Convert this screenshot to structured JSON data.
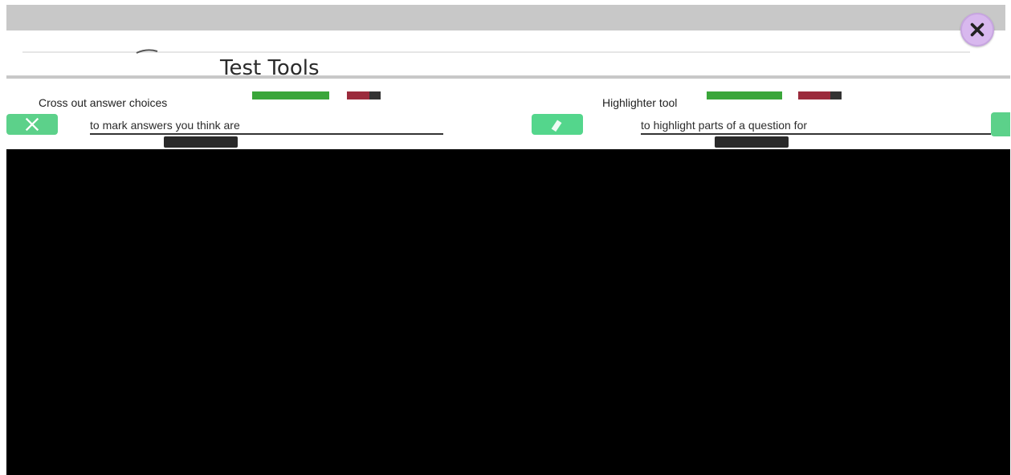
{
  "dialog": {
    "title": "Test Tools",
    "close_icon": "close-icon"
  },
  "tools": [
    {
      "heading": "Cross out answer choices",
      "description": "to mark answers you think are",
      "icon": "strikethrough-icon",
      "strip_colors": [
        "#3aa63a",
        "#9b2b3c",
        "#333333"
      ]
    },
    {
      "heading": "Highlighter tool",
      "description": "to highlight parts of a question for",
      "icon": "highlighter-icon",
      "strip_colors": [
        "#3aa63a",
        "#9b2b3c",
        "#333333"
      ]
    }
  ],
  "colors": {
    "accent_green": "#5cd18a",
    "close_button": "#d8b8ee"
  }
}
